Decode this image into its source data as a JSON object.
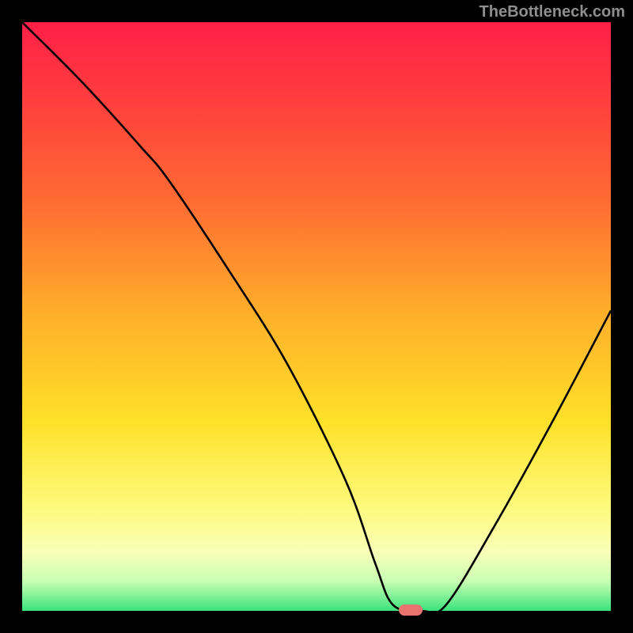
{
  "watermark": {
    "text": "TheBottleneck.com"
  },
  "marker": {
    "x_pct": 66,
    "y_pct": 100
  },
  "axes": {
    "xlim": [
      0,
      100
    ],
    "ylim": [
      0,
      100
    ]
  },
  "chart_data": {
    "type": "line",
    "title": "",
    "xlabel": "",
    "ylabel": "",
    "xlim": [
      0,
      100
    ],
    "ylim": [
      0,
      100
    ],
    "series": [
      {
        "name": "curve",
        "x": [
          0,
          10,
          20,
          25,
          35,
          45,
          55,
          60,
          63,
          68,
          72,
          80,
          90,
          100
        ],
        "values": [
          100,
          90,
          79,
          73,
          58,
          42,
          22,
          8,
          1,
          0,
          1,
          14,
          32,
          51
        ]
      }
    ],
    "marker_point": {
      "x": 66,
      "y": 0
    }
  }
}
